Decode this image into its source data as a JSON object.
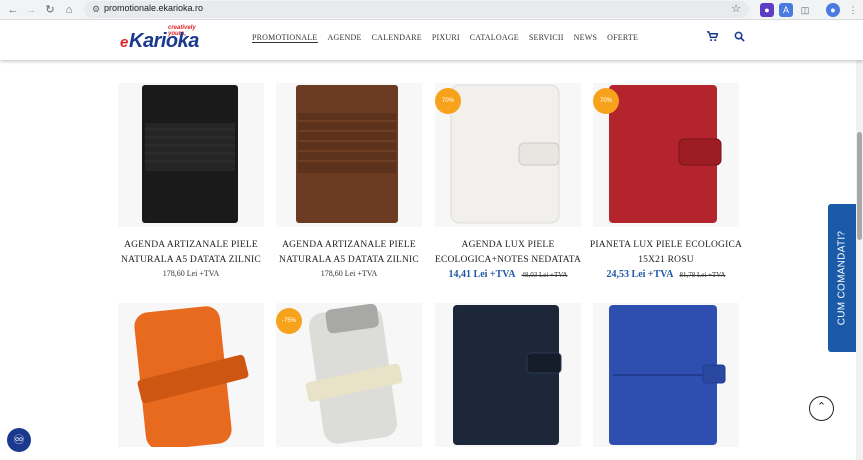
{
  "browser": {
    "url": "promotionale.ekarioka.ro"
  },
  "header": {
    "logo_tagline": "creatively yours,",
    "logo_e": "e",
    "logo_main": "Karioka",
    "menu": [
      "PROMOTIONALE",
      "AGENDE",
      "CALENDARE",
      "PIXURI",
      "CATALOAGE",
      "SERVICII",
      "NEWS",
      "OFERTE"
    ],
    "icons": [
      "cart-icon",
      "search-icon"
    ]
  },
  "products": [
    {
      "title": "AGENDA ARTIZANALE PIELE NATURALA A5 DATATA ZILNIC",
      "price": "178,60 Lei +TVA",
      "badge": "",
      "color": "#1a1a1a"
    },
    {
      "title": "AGENDA ARTIZANALE PIELE NATURALA A5 DATATA ZILNIC",
      "price": "178,60 Lei +TVA",
      "badge": "",
      "color": "#6b3b22"
    },
    {
      "title": "AGENDA LUX PIELE ECOLOGICA+NOTES NEDATATA",
      "price": "14,41 Lei +TVA",
      "old_price": "48,03 Lei +TVA",
      "badge": "70%",
      "color": "#f2f0ec"
    },
    {
      "title": "PIANETA LUX PIELE ECOLOGICA 15X21 ROSU",
      "price": "24,53 Lei +TVA",
      "old_price": "81,78 Lei +TVA",
      "badge": "70%",
      "color": "#b3242c"
    },
    {
      "title": "",
      "price": "",
      "badge": "",
      "color": "#e86a1e"
    },
    {
      "title": "",
      "price": "",
      "badge": "-75%",
      "color": "#dcdcd8"
    },
    {
      "title": "",
      "price": "",
      "badge": "",
      "color": "#1c2739"
    },
    {
      "title": "",
      "price": "",
      "badge": "",
      "color": "#2e4fb0"
    }
  ],
  "side_tab": {
    "label": "CUM COMANDATI?"
  },
  "colors": {
    "brand_blue": "#1b3a8f",
    "accent_orange": "#f7a21b",
    "sale_blue": "#1f5aa6"
  }
}
